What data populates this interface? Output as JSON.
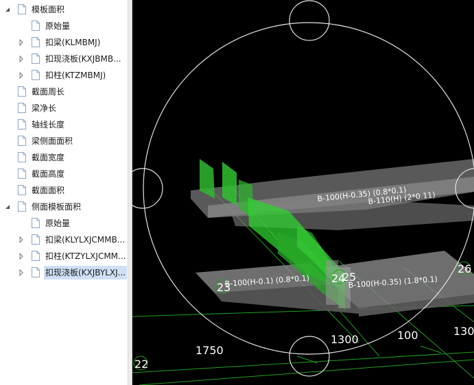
{
  "tree": {
    "items": [
      {
        "label": "模板面积",
        "level": 0,
        "expander": "expanded"
      },
      {
        "label": "原始量",
        "level": 1,
        "expander": "none"
      },
      {
        "label": "扣梁(KLMBMJ)",
        "level": 1,
        "expander": "collapsed"
      },
      {
        "label": "扣现浇板(KXJBMB...",
        "level": 1,
        "expander": "collapsed"
      },
      {
        "label": "扣柱(KTZMBMJ)",
        "level": 1,
        "expander": "collapsed"
      },
      {
        "label": "截面周长",
        "level": 0,
        "expander": "none"
      },
      {
        "label": "梁净长",
        "level": 0,
        "expander": "none"
      },
      {
        "label": "轴线长度",
        "level": 0,
        "expander": "none"
      },
      {
        "label": "梁侧面面积",
        "level": 0,
        "expander": "none"
      },
      {
        "label": "截面宽度",
        "level": 0,
        "expander": "none"
      },
      {
        "label": "截面高度",
        "level": 0,
        "expander": "none"
      },
      {
        "label": "截面面积",
        "level": 0,
        "expander": "none"
      },
      {
        "label": "侧面模板面积",
        "level": 0,
        "expander": "expanded"
      },
      {
        "label": "原始量",
        "level": 1,
        "expander": "none"
      },
      {
        "label": "扣梁(KLYLXJCMMB...",
        "level": 1,
        "expander": "collapsed"
      },
      {
        "label": "扣柱(KTZYLXJCMM...",
        "level": 1,
        "expander": "collapsed"
      },
      {
        "label": "扣现浇板(KXJBYLXJ...",
        "level": 1,
        "expander": "collapsed",
        "selected": true
      }
    ]
  },
  "viewport": {
    "slab_labels": {
      "upper_1": "B-100(H-0.35) (0.8*0.1)",
      "upper_2": "B-110(H) (2*0.11)",
      "lower_left": "B-100(H-0.1) (0.8*0.1)",
      "lower_right": "B-100(H-0.35) (1.8*0.1)"
    },
    "axis_labels": {
      "axis_23": "23",
      "axis_24": "24",
      "axis_25": "25",
      "axis_26": "26",
      "axis_22": "22"
    },
    "dimensions": {
      "d1750": "1750",
      "d1300": "1300",
      "d100": "100",
      "d130": "130"
    },
    "colors": {
      "background": "#000000",
      "grid_line": "#1fa11f",
      "slab": "#8a8a8a",
      "beam": "#2fd02f",
      "circle": "#e6e6e6"
    }
  }
}
